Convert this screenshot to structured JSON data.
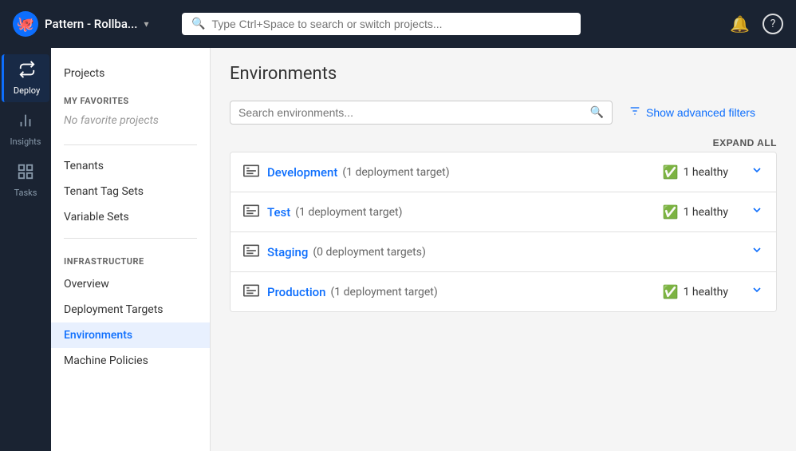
{
  "header": {
    "logo_text": "🐙",
    "project_name": "Pattern - Rollba...",
    "dropdown_label": "▾",
    "search_placeholder": "Type Ctrl+Space to search or switch projects...",
    "notification_icon": "🔔",
    "help_icon": "?"
  },
  "sidebar": {
    "items": [
      {
        "id": "deploy",
        "label": "Deploy",
        "icon": "⬆",
        "active": true
      },
      {
        "id": "insights",
        "label": "Insights",
        "icon": "📈",
        "active": false
      },
      {
        "id": "tasks",
        "label": "Tasks",
        "icon": "⊞",
        "active": false
      }
    ]
  },
  "secondary_sidebar": {
    "top_link": "Projects",
    "favorites_label": "MY FAVORITES",
    "no_favorites": "No favorite projects",
    "section_links_1": [
      {
        "id": "tenants",
        "label": "Tenants",
        "active": false
      },
      {
        "id": "tenant-tag-sets",
        "label": "Tenant Tag Sets",
        "active": false
      },
      {
        "id": "variable-sets",
        "label": "Variable Sets",
        "active": false
      }
    ],
    "infrastructure_label": "INFRASTRUCTURE",
    "section_links_2": [
      {
        "id": "overview",
        "label": "Overview",
        "active": false
      },
      {
        "id": "deployment-targets",
        "label": "Deployment Targets",
        "active": false
      },
      {
        "id": "environments",
        "label": "Environments",
        "active": true
      },
      {
        "id": "machine-policies",
        "label": "Machine Policies",
        "active": false
      }
    ]
  },
  "main": {
    "page_title": "Environments",
    "search_placeholder": "Search environments...",
    "advanced_filter_label": "Show advanced filters",
    "expand_all_label": "EXPAND ALL",
    "environments": [
      {
        "id": "development",
        "name": "Development",
        "targets": "(1 deployment target)",
        "status_text": "1 healthy",
        "has_status": true
      },
      {
        "id": "test",
        "name": "Test",
        "targets": "(1 deployment target)",
        "status_text": "1 healthy",
        "has_status": true
      },
      {
        "id": "staging",
        "name": "Staging",
        "targets": "(0 deployment targets)",
        "status_text": "",
        "has_status": false
      },
      {
        "id": "production",
        "name": "Production",
        "targets": "(1 deployment target)",
        "status_text": "1 healthy",
        "has_status": true
      }
    ]
  },
  "colors": {
    "brand_blue": "#0d6efd",
    "dark_bg": "#1a2332",
    "healthy_green": "#28a745"
  }
}
